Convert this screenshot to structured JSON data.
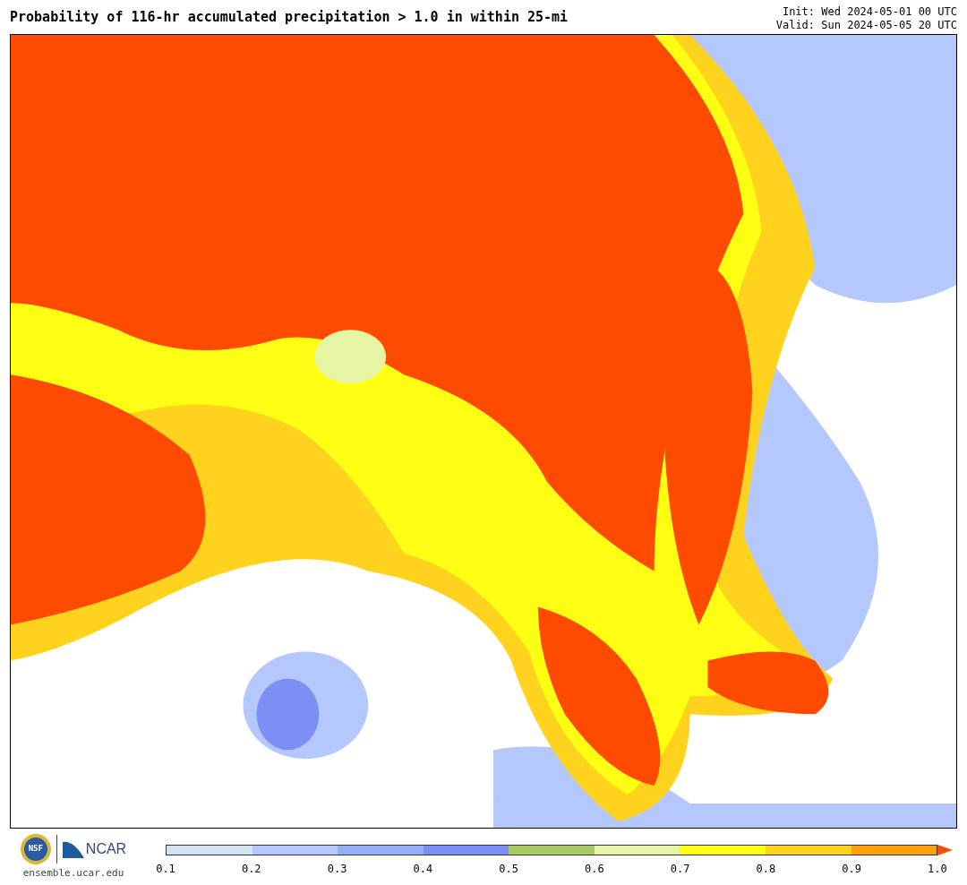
{
  "title": "Probability of 116-hr accumulated precipitation > 1.0 in within 25-mi",
  "init": "Init: Wed 2024-05-01 00 UTC",
  "valid": "Valid: Sun 2024-05-05 20 UTC",
  "logos": {
    "nsf": "NSF",
    "ncar": "NCAR",
    "url": "ensemble.ucar.edu"
  },
  "colorbar": {
    "bins": [
      {
        "color": "#d6e3f0"
      },
      {
        "color": "#b4c8ff"
      },
      {
        "color": "#96affa"
      },
      {
        "color": "#7b8ff5"
      },
      {
        "color": "#a7cc66"
      },
      {
        "color": "#e6f5a3"
      },
      {
        "color": "#ffff14"
      },
      {
        "color": "#ffd21e"
      },
      {
        "color": "#ffa00a"
      },
      {
        "color": "#ff4b00",
        "kind": "arrow"
      }
    ],
    "ticks": [
      "0.1",
      "0.2",
      "0.3",
      "0.4",
      "0.5",
      "0.6",
      "0.7",
      "0.8",
      "0.9",
      "1.0"
    ]
  }
}
